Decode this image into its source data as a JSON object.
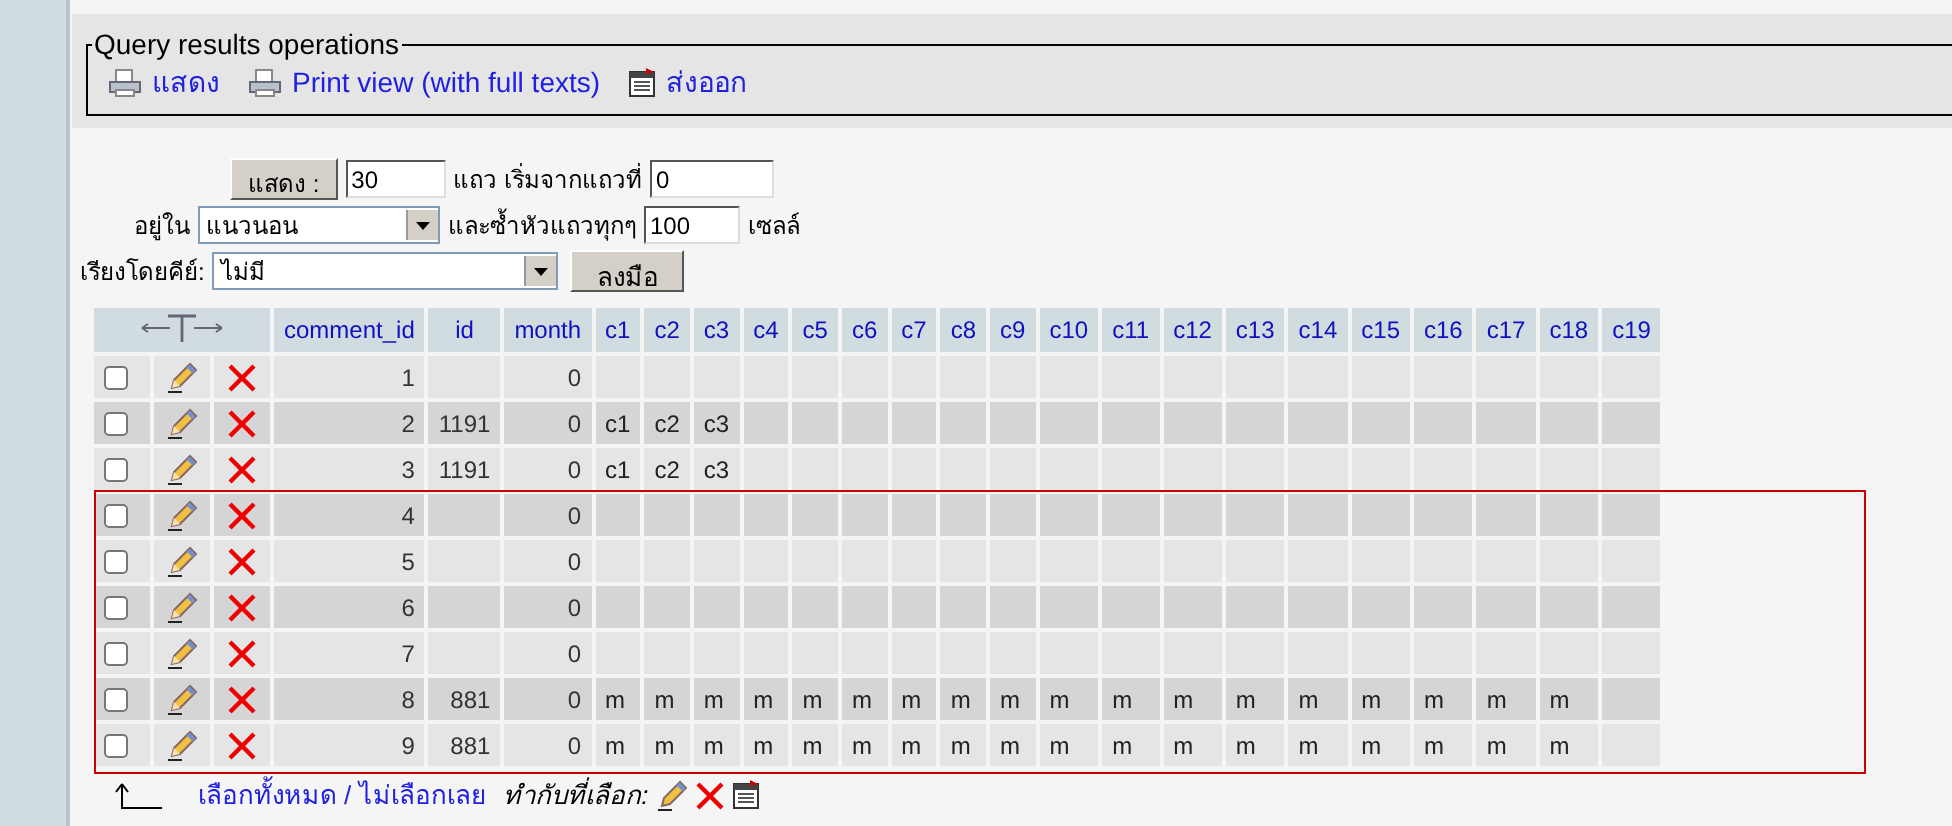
{
  "operations": {
    "legend": "Query results operations",
    "links": [
      {
        "kind": "print",
        "label": "แสดง"
      },
      {
        "kind": "print",
        "label": "Print view (with full texts)"
      },
      {
        "kind": "export",
        "label": "ส่งออก"
      }
    ]
  },
  "navigation": {
    "show_button": "แสดง :",
    "rows_value": "30",
    "rows_label": "แถว เริ่มจากแถวที่",
    "start_value": "0",
    "mode_label": "อยู่ใน",
    "mode_value": "แนวนอน",
    "repeat_label": "และซ้ำหัวแถวทุกๆ",
    "repeat_value": "100",
    "cells_label": "เซลล์",
    "sort_label": "เรียงโดยคีย์:",
    "sort_value": "ไม่มี",
    "go_button": "ลงมือ"
  },
  "table": {
    "columns": [
      "comment_id",
      "id",
      "month",
      "c1",
      "c2",
      "c3",
      "c4",
      "c5",
      "c6",
      "c7",
      "c8",
      "c9",
      "c10",
      "c11",
      "c12",
      "c13",
      "c14",
      "c15",
      "c16",
      "c17",
      "c18",
      "c19"
    ],
    "rows": [
      {
        "checked": false,
        "cells": [
          "1",
          null,
          "0",
          null,
          null,
          null,
          null,
          null,
          null,
          null,
          null,
          null,
          null,
          null,
          null,
          null,
          null,
          null,
          null,
          null,
          null,
          null
        ]
      },
      {
        "checked": false,
        "cells": [
          "2",
          "1191",
          "0",
          "c1",
          "c2",
          "c3",
          null,
          null,
          null,
          null,
          null,
          null,
          null,
          null,
          null,
          null,
          null,
          null,
          null,
          null,
          null,
          null
        ]
      },
      {
        "checked": false,
        "cells": [
          "3",
          "1191",
          "0",
          "c1",
          "c2",
          "c3",
          null,
          null,
          null,
          null,
          null,
          null,
          null,
          null,
          null,
          null,
          null,
          null,
          null,
          null,
          null,
          null
        ]
      }
    ],
    "framed_rows": [
      {
        "checked": false,
        "cells": [
          "4",
          null,
          "0",
          null,
          null,
          null,
          null,
          null,
          null,
          null,
          null,
          null,
          null,
          null,
          null,
          null,
          null,
          null,
          null,
          null,
          null,
          null
        ]
      },
      {
        "checked": false,
        "cells": [
          "5",
          null,
          "0",
          null,
          null,
          null,
          null,
          null,
          null,
          null,
          null,
          null,
          null,
          null,
          null,
          null,
          null,
          null,
          null,
          null,
          null,
          null
        ]
      },
      {
        "checked": false,
        "cells": [
          "6",
          null,
          "0",
          null,
          null,
          null,
          null,
          null,
          null,
          null,
          null,
          null,
          null,
          null,
          null,
          null,
          null,
          null,
          null,
          null,
          null,
          null
        ]
      },
      {
        "checked": false,
        "cells": [
          "7",
          null,
          "0",
          null,
          null,
          null,
          null,
          null,
          null,
          null,
          null,
          null,
          null,
          null,
          null,
          null,
          null,
          null,
          null,
          null,
          null,
          null
        ]
      },
      {
        "checked": false,
        "cells": [
          "8",
          "881",
          "0",
          "m",
          "m",
          "m",
          "m",
          "m",
          "m",
          "m",
          "m",
          "m",
          "m",
          "m",
          "m",
          "m",
          "m",
          "m",
          "m",
          "m",
          "m",
          null
        ]
      },
      {
        "checked": false,
        "cells": [
          "9",
          "881",
          "0",
          "m",
          "m",
          "m",
          "m",
          "m",
          "m",
          "m",
          "m",
          "m",
          "m",
          "m",
          "m",
          "m",
          "m",
          "m",
          "m",
          "m",
          "m",
          null
        ]
      }
    ]
  },
  "footer": {
    "check_all": "เลือกทั้งหมด",
    "separator": "/",
    "uncheck_all": "ไม่เลือกเลย",
    "with_selected": "ทำกับที่เลือก:"
  }
}
